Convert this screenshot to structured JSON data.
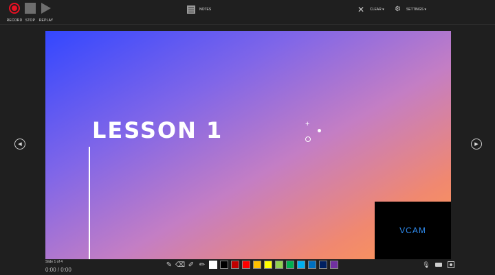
{
  "toolbar": {
    "record_label": "RECORD",
    "stop_label": "STOP",
    "replay_label": "REPLAY",
    "notes_label": "NOTES",
    "clear_label": "CLEAR ▾",
    "settings_label": "SETTINGS ▾"
  },
  "nav": {
    "prev_icon": "◀",
    "next_icon": "▶"
  },
  "slide": {
    "title": "LESSON 1",
    "vcam_label": "VCAM"
  },
  "status": {
    "slide_counter": "Slide 1 of 4",
    "timer": "0:00  /  0:00"
  },
  "ink_tools": [
    "pen",
    "eraser",
    "pen-crossed",
    "highlighter"
  ],
  "colors": {
    "recording": "#e81123",
    "accent_vcam": "#2f8cf0",
    "palette": [
      "#ffffff",
      "#000000",
      "#c00000",
      "#ff0000",
      "#ffc000",
      "#ffff00",
      "#92d050",
      "#00b050",
      "#00b0f0",
      "#0070c0",
      "#002060",
      "#7030a0"
    ]
  },
  "icons": {
    "record": "record-icon",
    "stop": "stop-icon",
    "replay": "replay-icon",
    "notes": "notes-icon",
    "clear": "close-icon",
    "settings": "gear-icon",
    "mic": "microphone-icon",
    "camera": "camera-icon",
    "camera_preview": "camera-preview-icon"
  }
}
